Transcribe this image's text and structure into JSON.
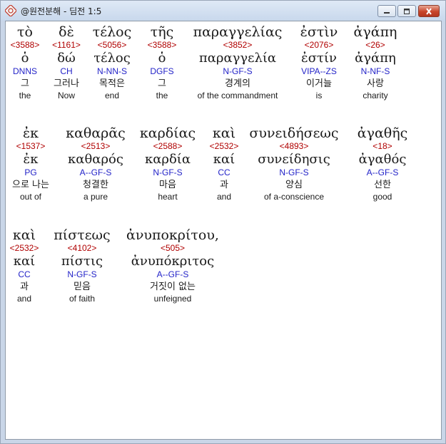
{
  "window": {
    "title": "@원전분해 - 딤전 1:5",
    "minimize_label": "",
    "maximize_label": "",
    "close_label": ""
  },
  "rows": [
    [
      {
        "greek": "τὸ",
        "strongs": "<3588>",
        "lemma": "ὁ",
        "parsing": "DNNS",
        "korean": "그",
        "english": "the"
      },
      {
        "greek": "δὲ",
        "strongs": "<1161>",
        "lemma": "δώ",
        "parsing": "CH",
        "korean": "그러나",
        "english": "Now"
      },
      {
        "greek": "τέλος",
        "strongs": "<5056>",
        "lemma": "τέλος",
        "parsing": "N-NN-S",
        "korean": "목적은",
        "english": "end"
      },
      {
        "greek": "τῆς",
        "strongs": "<3588>",
        "lemma": "ὁ",
        "parsing": "DGFS",
        "korean": "그",
        "english": "the"
      },
      {
        "greek": "παραγγελίας",
        "strongs": "<3852>",
        "lemma": "παραγγελία",
        "parsing": "N-GF-S",
        "korean": "경계의",
        "english": "of the commandment"
      },
      {
        "greek": "ἐστὶν",
        "strongs": "<2076>",
        "lemma": "ἐστίν",
        "parsing": "VIPA--ZS",
        "korean": "이거늘",
        "english": "is"
      },
      {
        "greek": "ἀγάπη",
        "strongs": "<26>",
        "lemma": "ἀγάπη",
        "parsing": "N-NF-S",
        "korean": "사랑",
        "english": "charity"
      }
    ],
    [
      {
        "greek": "ἐκ",
        "strongs": "<1537>",
        "lemma": "ἐκ",
        "parsing": "PG",
        "korean": "으로 나는",
        "english": "out of"
      },
      {
        "greek": "καθαρᾶς",
        "strongs": "<2513>",
        "lemma": "καθαρός",
        "parsing": "A--GF-S",
        "korean": "청결한",
        "english": "a pure"
      },
      {
        "greek": "καρδίας",
        "strongs": "<2588>",
        "lemma": "καρδία",
        "parsing": "N-GF-S",
        "korean": "마음",
        "english": "heart"
      },
      {
        "greek": "καὶ",
        "strongs": "<2532>",
        "lemma": "καί",
        "parsing": "CC",
        "korean": "과",
        "english": "and"
      },
      {
        "greek": "συνειδήσεως",
        "strongs": "<4893>",
        "lemma": "συνείδησις",
        "parsing": "N-GF-S",
        "korean": "양심",
        "english": "of a-conscience"
      },
      {
        "greek": "ἀγαθῆς",
        "strongs": "<18>",
        "lemma": "ἀγαθός",
        "parsing": "A--GF-S",
        "korean": "선한",
        "english": "good"
      }
    ],
    [
      {
        "greek": "καὶ",
        "strongs": "<2532>",
        "lemma": "καί",
        "parsing": "CC",
        "korean": "과",
        "english": "and"
      },
      {
        "greek": "πίστεως",
        "strongs": "<4102>",
        "lemma": "πίστις",
        "parsing": "N-GF-S",
        "korean": "믿음",
        "english": "of faith"
      },
      {
        "greek": "ἀνυποκρίτου,",
        "strongs": "<505>",
        "lemma": "ἀνυπόκριτος",
        "parsing": "A--GF-S",
        "korean": "거짓이 없는",
        "english": "unfeigned"
      }
    ]
  ],
  "colors": {
    "strongs": "#b00000",
    "parsing": "#2323c8",
    "text": "#1a1a1a",
    "selection": "#ffffff"
  },
  "icons": {
    "app": "bible-app-icon",
    "minimize": "minimize-icon",
    "maximize": "maximize-icon",
    "close": "close-icon"
  }
}
